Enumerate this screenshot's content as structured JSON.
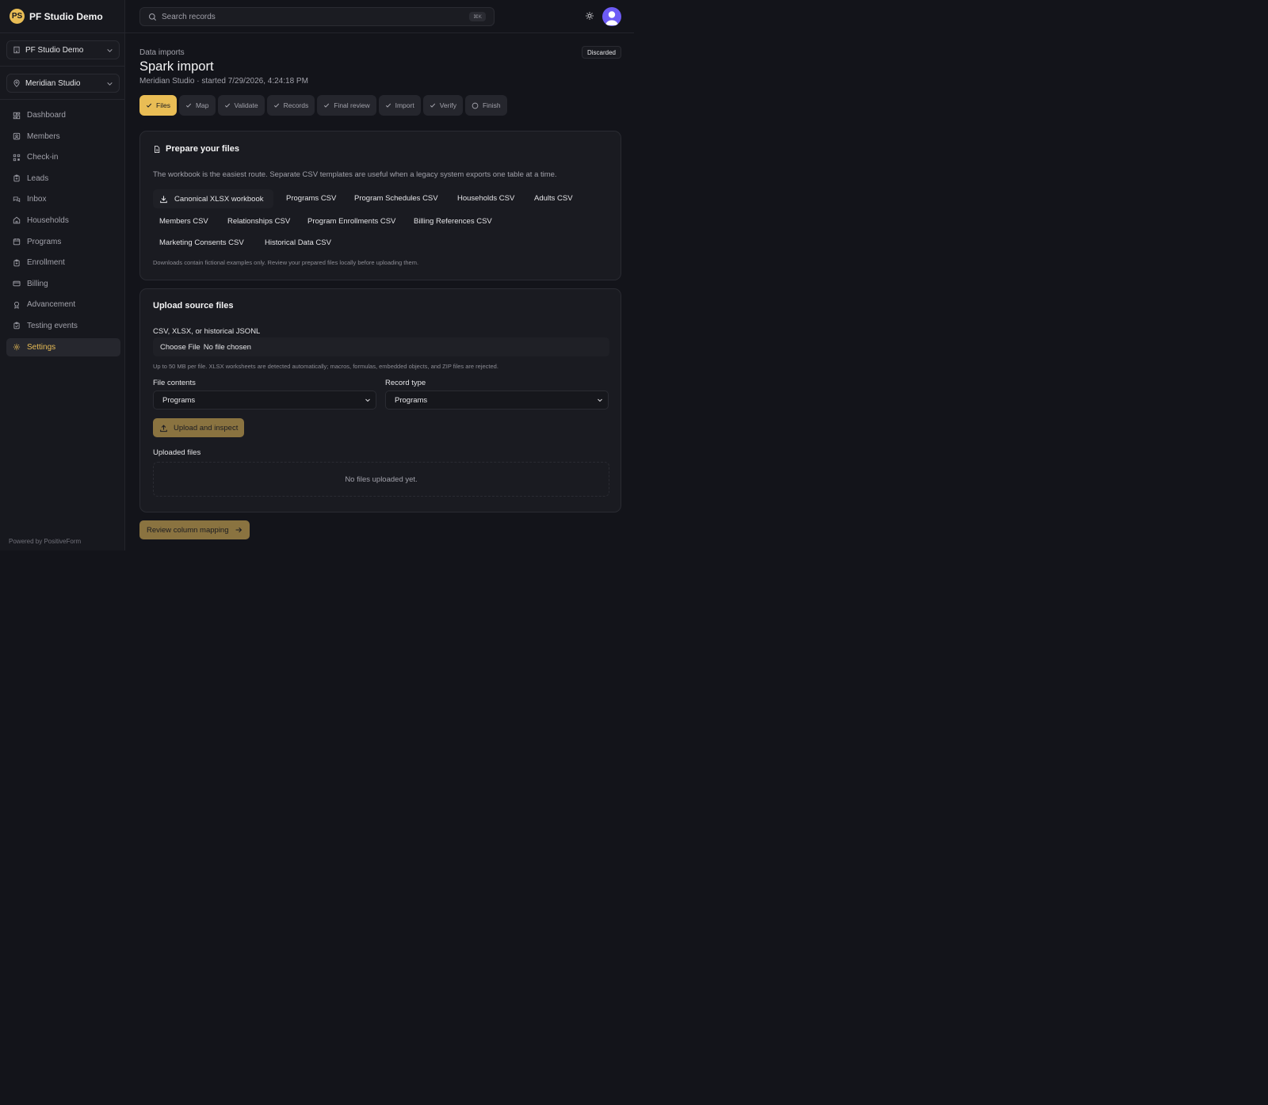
{
  "sidebar": {
    "logo_text": "PS",
    "brand": "PF Studio Demo",
    "org_selector": "PF Studio Demo",
    "location_selector": "Meridian Studio",
    "items": [
      {
        "label": "Dashboard",
        "icon": "dashboard-icon"
      },
      {
        "label": "Members",
        "icon": "members-icon"
      },
      {
        "label": "Check-in",
        "icon": "check-in-icon"
      },
      {
        "label": "Leads",
        "icon": "leads-icon"
      },
      {
        "label": "Inbox",
        "icon": "inbox-icon"
      },
      {
        "label": "Households",
        "icon": "home-icon"
      },
      {
        "label": "Programs",
        "icon": "calendar-icon"
      },
      {
        "label": "Enrollment",
        "icon": "clipboard-icon"
      },
      {
        "label": "Billing",
        "icon": "card-icon"
      },
      {
        "label": "Advancement",
        "icon": "award-icon"
      },
      {
        "label": "Testing events",
        "icon": "clipboard-check-icon"
      },
      {
        "label": "Settings",
        "icon": "gear-icon",
        "active": true
      }
    ],
    "footer": "Powered by PositiveForm"
  },
  "topbar": {
    "search_placeholder": "Search records",
    "shortcut": "⌘K"
  },
  "page": {
    "breadcrumb": "Data imports",
    "title": "Spark import",
    "subtitle": "Meridian Studio · started 7/29/2026, 4:24:18 PM",
    "status_badge": "Discarded"
  },
  "steps": [
    {
      "label": "Files",
      "state": "active"
    },
    {
      "label": "Map",
      "state": "done"
    },
    {
      "label": "Validate",
      "state": "done"
    },
    {
      "label": "Records",
      "state": "done"
    },
    {
      "label": "Final review",
      "state": "done"
    },
    {
      "label": "Import",
      "state": "done"
    },
    {
      "label": "Verify",
      "state": "done"
    },
    {
      "label": "Finish",
      "state": "pending"
    }
  ],
  "prepare": {
    "title": "Prepare your files",
    "description": "The workbook is the easiest route. Separate CSV templates are useful when a legacy system exports one table at a time.",
    "workbook": "Canonical XLSX workbook",
    "templates": [
      "Programs CSV",
      "Program Schedules CSV",
      "Households CSV",
      "Adults CSV",
      "Members CSV",
      "Relationships CSV",
      "Program Enrollments CSV",
      "Billing References CSV",
      "Marketing Consents CSV",
      "Historical Data CSV"
    ],
    "note": "Downloads contain fictional examples only. Review your prepared files locally before uploading them."
  },
  "upload": {
    "title": "Upload source files",
    "file_label": "CSV, XLSX, or historical JSONL",
    "file_button": "Choose File",
    "file_status": "No file chosen",
    "hint": "Up to 50 MB per file. XLSX worksheets are detected automatically; macros, formulas, embedded objects, and ZIP files are rejected.",
    "contents_label": "File contents",
    "contents_value": "Programs",
    "record_type_label": "Record type",
    "record_type_value": "Programs",
    "submit": "Upload and inspect",
    "uploaded_label": "Uploaded files",
    "empty": "No files uploaded yet."
  },
  "footer_action": "Review column mapping",
  "colors": {
    "accent": "#e9bd55",
    "accent_muted": "#8a7340",
    "background": "#13141a",
    "avatar": "#6d5bf5"
  }
}
